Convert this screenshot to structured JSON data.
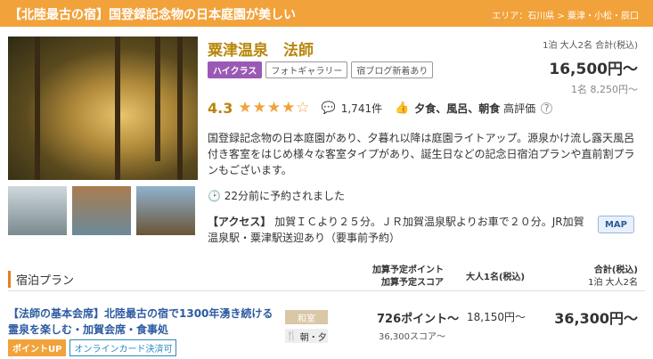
{
  "header": {
    "title": "【北陸最古の宿】国登録記念物の日本庭園が美しい",
    "area": "エリア：石川県 > 粟津・小松・辰口"
  },
  "hotel": {
    "name": "粟津温泉　法師",
    "tags": [
      "ハイクラス",
      "フォトギャラリー",
      "宿ブログ新着あり"
    ],
    "rating": "4.3",
    "stars": "★★★★☆",
    "review_count": "1,741件",
    "praise_items": "夕食、風呂、朝食",
    "praise_suffix": "高評価",
    "description": "国登録記念物の日本庭園があり、夕暮れ以降は庭園ライトアップ。源泉かけ流し露天風呂付き客室をはじめ様々な客室タイプがあり、誕生日などの記念日宿泊プランや直前割プランもございます。",
    "recent_booking": "22分前に予約されました",
    "access_label": "【アクセス】",
    "access_text": "加賀ＩＣより２５分。ＪＲ加賀温泉駅よりお車で２０分。JR加賀温泉駅・粟津駅送迎あり（要事前予約）",
    "map_label": "MAP"
  },
  "price": {
    "condition": "1泊 大人2名 合計(税込)",
    "total": "16,500円〜",
    "per_person": "1名 8,250円〜"
  },
  "plans": {
    "heading": "宿泊プラン",
    "col_points": "加算予定ポイント",
    "col_score": "加算予定スコア",
    "col_adult": "大人1名(税込)",
    "col_total": "合計(税込)",
    "col_total_sub": "1泊 大人2名",
    "items": [
      {
        "name": "【法師の基本会席】北陸最古の宿で1300年湧き続ける霊泉を楽しむ・加賀会席・食事処",
        "badges": [
          "ポイントUP",
          "オンラインカード決済可"
        ],
        "room_type": "和室",
        "meal": "朝・夕",
        "points": "726ポイント〜",
        "score": "36,300スコア〜",
        "adult_price": "18,150円〜",
        "total_price": "36,300円〜"
      }
    ]
  },
  "colors": {
    "accent": "#f2a23a",
    "link": "#2c5aa0",
    "brand_gold": "#b8860b"
  }
}
